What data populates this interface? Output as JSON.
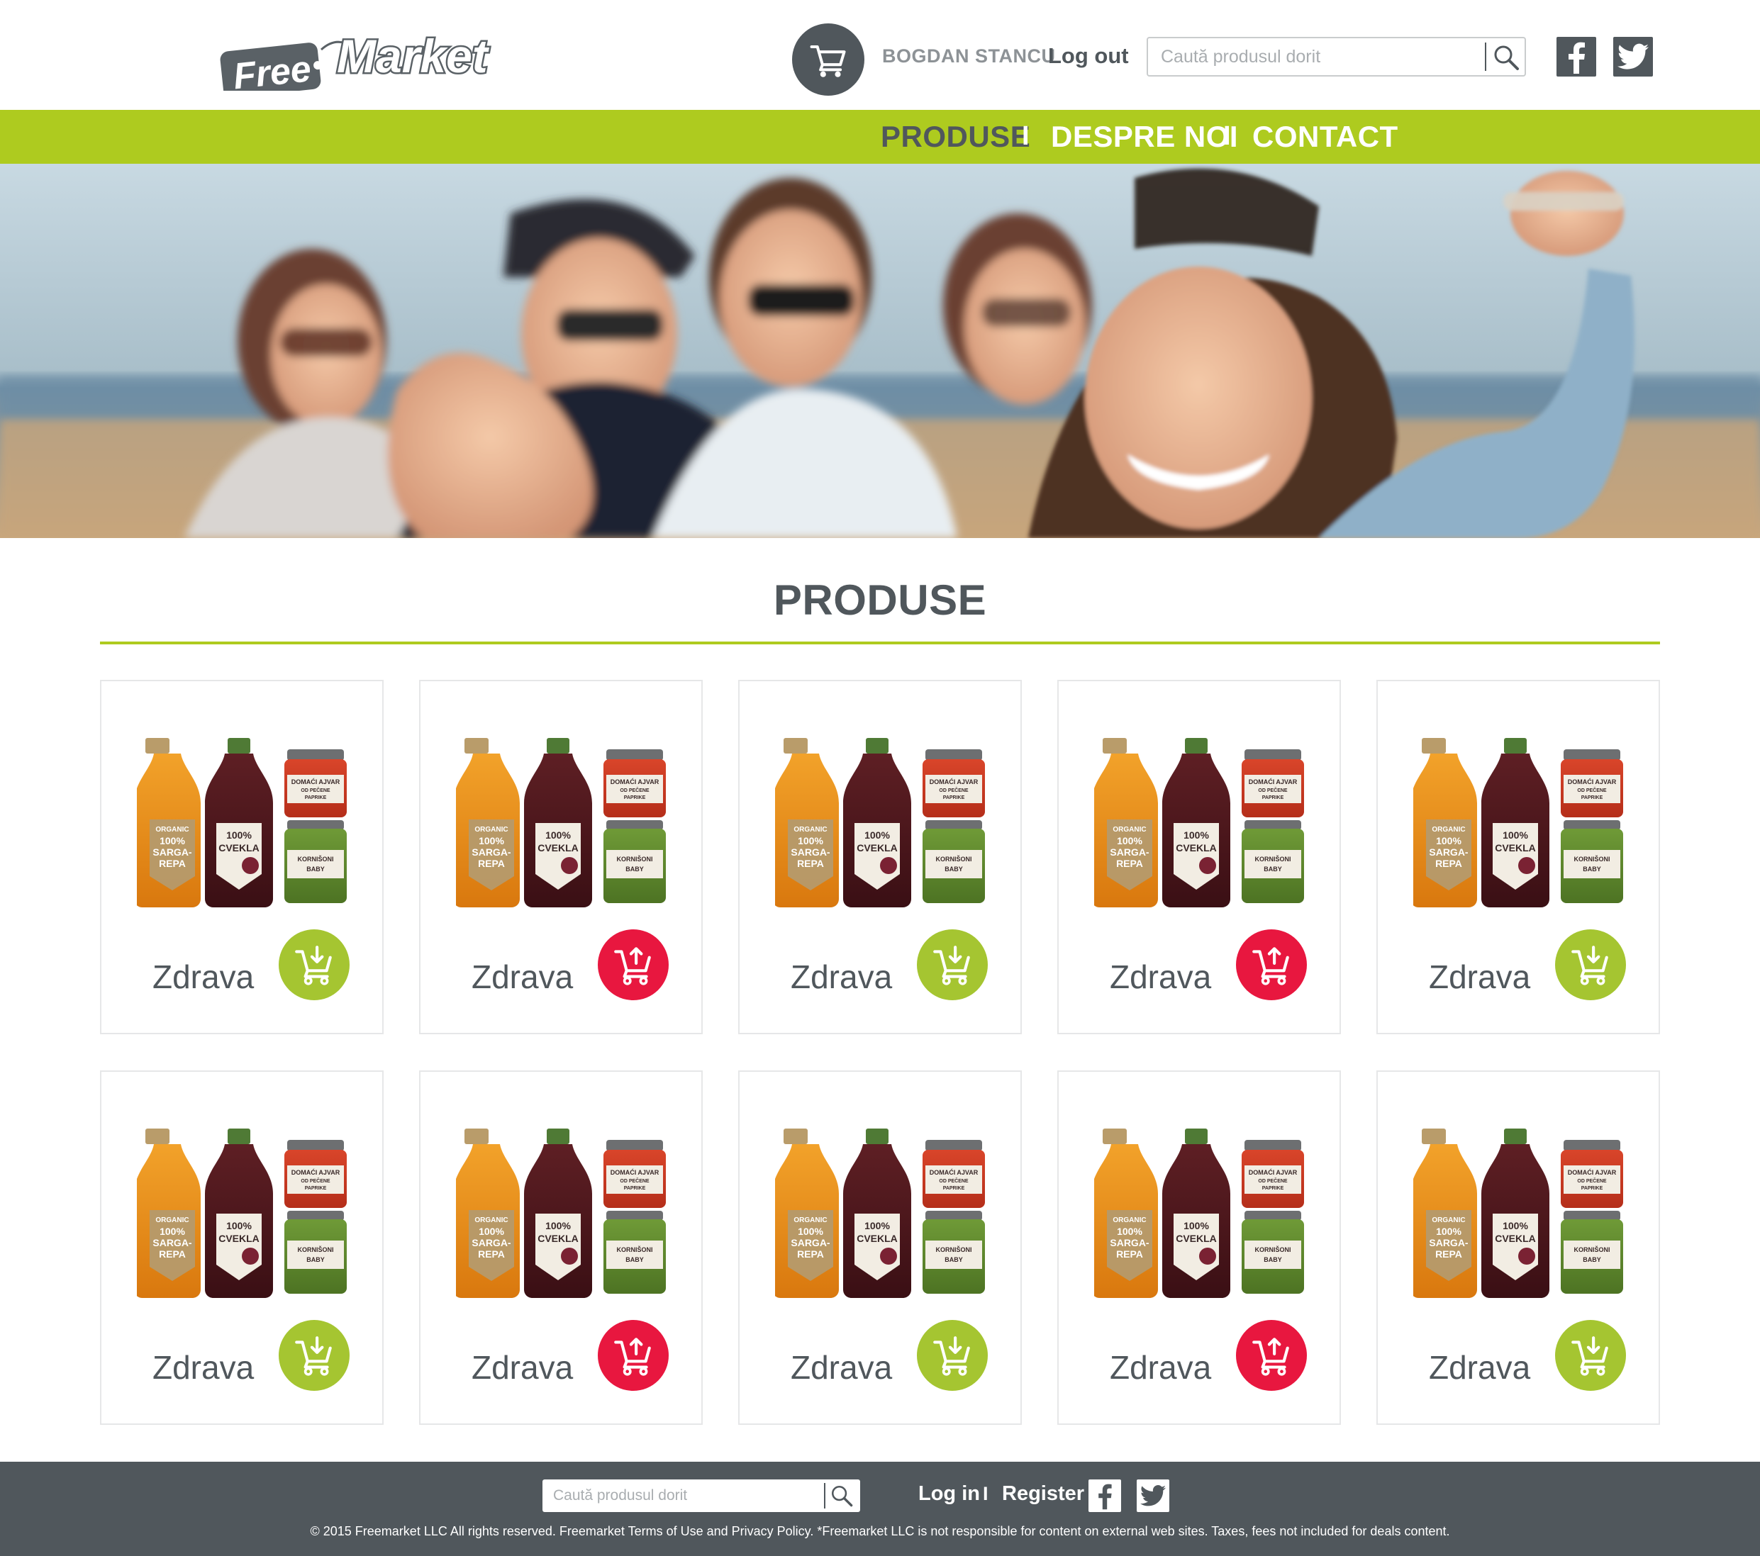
{
  "header": {
    "logo_text_free": "Free",
    "logo_text_market": "Market",
    "cart_icon": "shopping-cart-icon",
    "user_name": "BOGDAN STANCU",
    "logout_label": "Log out",
    "search_placeholder": "Caută produsul dorit",
    "search_icon": "search-icon",
    "social": [
      "facebook-icon",
      "twitter-icon"
    ]
  },
  "nav": {
    "items": [
      {
        "label": "PRODUSE",
        "active": true
      },
      {
        "label": "DESPRE NOI",
        "active": false
      },
      {
        "label": "CONTACT",
        "active": false
      }
    ],
    "separator": "I"
  },
  "products_section": {
    "title": "PRODUSE",
    "products": [
      {
        "name": "Zdrava",
        "cart_action": "add"
      },
      {
        "name": "Zdrava",
        "cart_action": "remove"
      },
      {
        "name": "Zdrava",
        "cart_action": "add"
      },
      {
        "name": "Zdrava",
        "cart_action": "remove"
      },
      {
        "name": "Zdrava",
        "cart_action": "add"
      },
      {
        "name": "Zdrava",
        "cart_action": "add"
      },
      {
        "name": "Zdrava",
        "cart_action": "remove"
      },
      {
        "name": "Zdrava",
        "cart_action": "add"
      },
      {
        "name": "Zdrava",
        "cart_action": "remove"
      },
      {
        "name": "Zdrava",
        "cart_action": "add"
      }
    ],
    "label_texts": {
      "organic": "ORGANIC",
      "sargarepa_1": "100%",
      "sargarepa_2": "SARGA-",
      "sargarepa_3": "REPA",
      "cvekla_1": "100%",
      "cvekla_2": "CVEKLA",
      "ajvar_1": "DOMAĆI AJVAR",
      "ajvar_2": "OD PEČENE",
      "ajvar_3": "PAPRIKE",
      "kornisoni_1": "KORNIŠONI",
      "kornisoni_2": "BABY"
    }
  },
  "footer": {
    "search_placeholder": "Caută produsul dorit",
    "login_label": "Log in",
    "separator": "I",
    "register_label": "Register",
    "copyright": "© 2015 Freemarket LLC All rights reserved. Freemarket Terms of Use and Privacy Policy. *Freemarket LLC is not responsible for content on external web sites. Taxes, fees not included for deals content."
  },
  "colors": {
    "brand_green": "#aecb1f",
    "add_green": "#a5c531",
    "remove_red": "#e8173f",
    "dark_gray": "#50575c"
  }
}
